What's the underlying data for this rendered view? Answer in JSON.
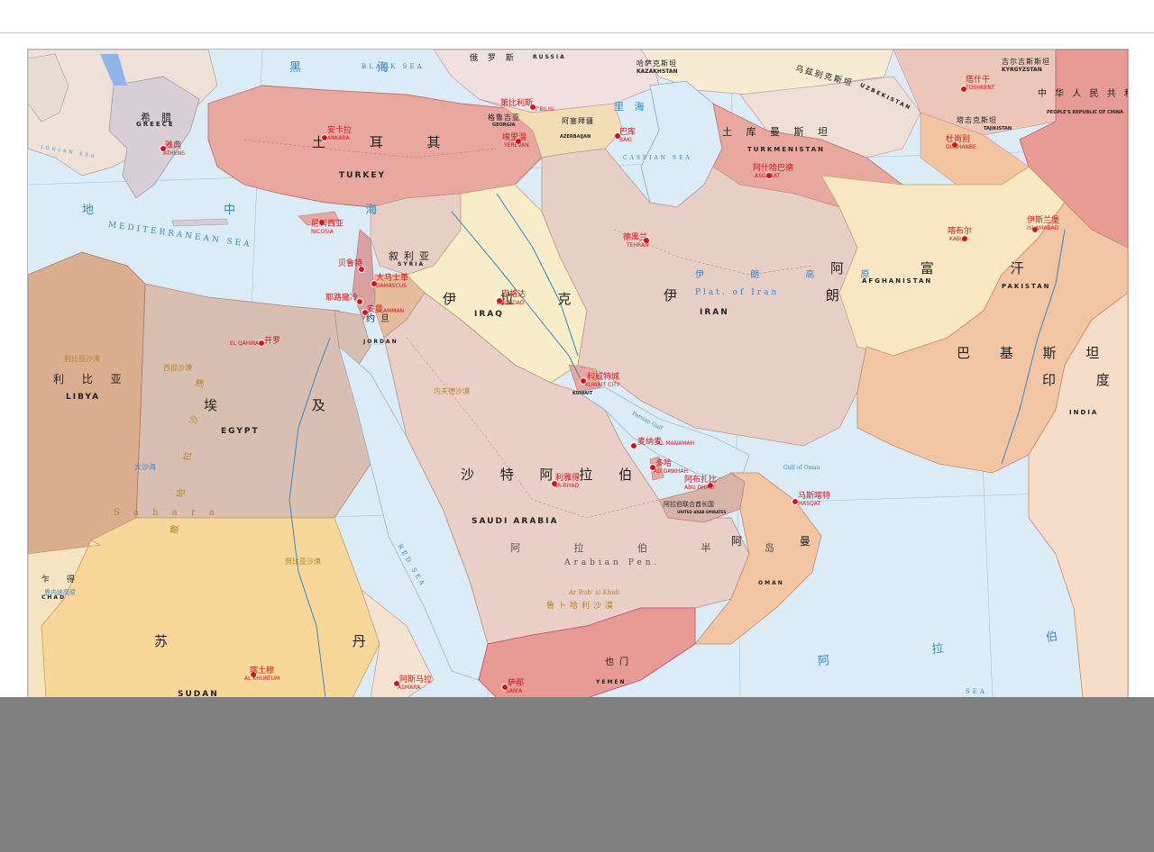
{
  "countries": {
    "turkey": {
      "cn": "土 耳 其",
      "en": "TURKEY"
    },
    "greece": {
      "cn": "希腊",
      "en": "GREECE"
    },
    "syria": {
      "cn": "叙利亚",
      "en": "SYRIA"
    },
    "iraq": {
      "cn": "伊 拉 克",
      "en": "IRAQ"
    },
    "iran": {
      "cn": "伊 朗",
      "en": "IRAN"
    },
    "jordan": {
      "cn": "约旦",
      "en": "JORDAN"
    },
    "egypt": {
      "cn": "埃 及",
      "en": "EGYPT"
    },
    "libya": {
      "cn": "利 比 亚",
      "en": "LIBYA"
    },
    "sudan": {
      "cn": "苏 丹",
      "en": "SUDAN"
    },
    "chad": {
      "cn": "乍 得",
      "en": "CHAD"
    },
    "saudi": {
      "cn": "沙 特 阿 拉 伯",
      "en": "SAUDI ARABIA"
    },
    "oman": {
      "cn": "阿 曼",
      "en": "OMAN"
    },
    "yemen": {
      "cn": "也门",
      "en": "YEMEN"
    },
    "afghanistan": {
      "cn": "阿 富 汗",
      "en": "AFGHANISTAN"
    },
    "pakistan": {
      "cn": "巴 基 斯 坦",
      "en": "PAKISTAN"
    },
    "india": {
      "cn": "印 度",
      "en": "INDIA"
    },
    "turkmenistan": {
      "cn": "土 库 曼 斯 坦",
      "en": "TURKMENISTAN"
    },
    "uzbekistan": {
      "cn": "乌兹别克斯坦",
      "en": "UZBEKISTAN"
    },
    "kazakhstan": {
      "cn": "哈萨克斯坦",
      "en": "KAZAKHSTAN"
    },
    "kyrgyzstan": {
      "cn": "吉尔吉斯斯坦",
      "en": "KYRGYZSTAN"
    },
    "tajikistan": {
      "cn": "塔吉克斯坦",
      "en": "TAJIKISTAN"
    },
    "china": {
      "cn": "中 华 人 民 共 和 国",
      "en": "PEOPLE'S REPUBLIC OF CHINA"
    },
    "russia": {
      "cn": "俄 罗 斯",
      "en": "RUSSIA"
    },
    "georgia": {
      "cn": "格鲁吉亚",
      "en": "GEORGIA"
    },
    "azerbaijan": {
      "cn": "阿塞拜疆",
      "en": "AZERBAIJAN"
    },
    "kuwait": {
      "en": "KUWAIT"
    },
    "uae": {
      "cn": "阿拉伯联合酋长国",
      "en": "UNITED ARAB EMIRATES"
    }
  },
  "capitals": {
    "ankara": {
      "cn": "安卡拉",
      "en": "ANKARA"
    },
    "baghdad": {
      "cn": "巴格达",
      "en": "BAGHDAD"
    },
    "tehran": {
      "cn": "德黑兰",
      "en": "TEHRAN"
    },
    "damascus": {
      "cn": "大马士革",
      "en": "DAMASCUS"
    },
    "amman": {
      "cn": "安曼",
      "en": "AMMAN"
    },
    "beirut": {
      "cn": "贝鲁特",
      "en": ""
    },
    "cairo": {
      "cn": "开罗",
      "en": "EL QAHIRA"
    },
    "riyadh": {
      "cn": "利雅得",
      "en": "AR-RIYAD"
    },
    "kuwait_city": {
      "cn": "科威特城",
      "en": "KUWAIT CITY"
    },
    "manama": {
      "cn": "麦纳麦",
      "en": "AL MANAMAH"
    },
    "doha": {
      "cn": "多哈",
      "en": "AD DAWHAH"
    },
    "abu_dhabi": {
      "cn": "阿布扎比",
      "en": "ABU DHABI"
    },
    "muscat": {
      "cn": "马斯喀特",
      "en": "MASQAT"
    },
    "kabul": {
      "cn": "喀布尔",
      "en": "KABUL"
    },
    "islamabad": {
      "cn": "伊斯兰堡",
      "en": "ISLAMABAD"
    },
    "ashgabat": {
      "cn": "阿什哈巴德",
      "en": "ASGABAT"
    },
    "tbilisi": {
      "cn": "第比利斯",
      "en": "T'BILISI"
    },
    "yerevan": {
      "cn": "埃里温",
      "en": "YEREVAN"
    },
    "baku": {
      "cn": "巴库",
      "en": "BAKI"
    },
    "khartoum": {
      "cn": "喀土穆",
      "en": "AL KHURTUM"
    },
    "asmara": {
      "cn": "阿斯马拉",
      "en": "ASMARA"
    },
    "sanaa": {
      "cn": "萨那",
      "en": "SAN'A"
    },
    "dushanbe": {
      "cn": "杜尚别",
      "en": "DUSHANBE"
    },
    "tashkent": {
      "cn": "塔什干",
      "en": "TOSHKENT"
    },
    "nicosia": {
      "cn": "尼科西亚",
      "en": "NICOSIA"
    },
    "athens": {
      "cn": "雅典",
      "en": "ATHENS"
    },
    "jerusalem": {
      "cn": "耶路撒冷",
      "en": ""
    }
  },
  "seas": {
    "black_sea_cn": "黑 海",
    "black_sea_en": "BLACK SEA",
    "caspian_cn": "里 海",
    "caspian_en": "CASPIAN SEA",
    "med_cn": "地 中 海",
    "med_en": "MEDITERRANEAN SEA",
    "red_sea_en": "RED SEA",
    "arabian_sea_cn": "阿 拉 伯 海",
    "arabian_sea_en": "SEA",
    "ionian_en": "IONIAN SEA",
    "gulf_of_oman": "Gulf of Oman",
    "persian_gulf": "Persian Gulf"
  },
  "regions": {
    "arabian_pen_cn": "阿 拉 伯 半 岛",
    "arabian_pen_en": "Arabian Pen.",
    "iran_plat_cn": "伊 朗 高 原",
    "iran_plat_en": "Plat. of Iran",
    "nafud": "内夫德沙漠",
    "rub_al_khali": "鲁卜哈利沙漠",
    "rub_al_khali_en": "Ar Rub' al Khali",
    "sahara_cn": "撒 哈 拉 沙 漠",
    "sahara_en": "S a h a r a",
    "great_sand_sea": "大沙海",
    "libyan_desert": "利比亚沙漠",
    "nubian": "努比亚沙漠",
    "western_desert": "西部沙漠",
    "ennedi": "恩内迪高原"
  },
  "colors": {
    "sea": "#dcecf6",
    "turkey_fill": "#e8a8a0",
    "iran_fill": "#e8cfc6",
    "iraq_fill": "#f7edc8",
    "saudi_fill": "#e9cfc7",
    "egypt_fill": "#d9bfb1",
    "libya_fill": "#dcae90",
    "sudan_fill": "#f7d89a",
    "afghan_fill": "#f9e7c4",
    "pakistan_fill": "#f2c6a4",
    "turkmen_fill": "#e8a8a0",
    "capital_red": "#d0141a"
  }
}
